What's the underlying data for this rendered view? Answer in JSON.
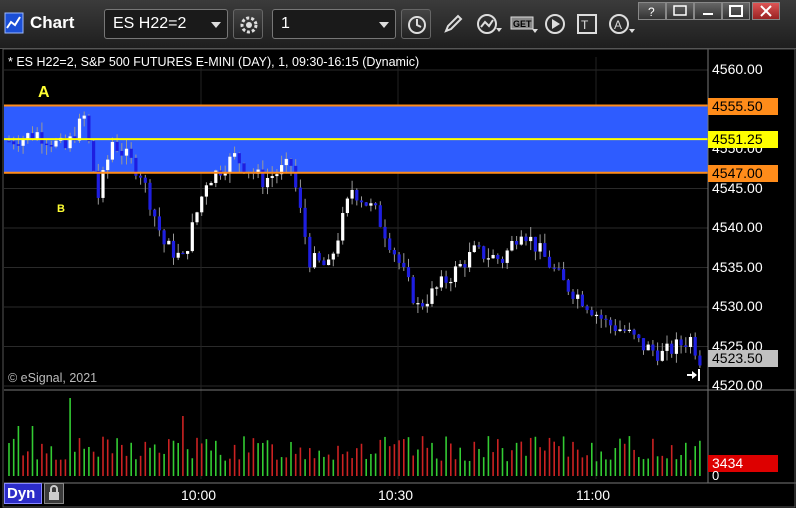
{
  "window": {
    "title": "Chart",
    "symbol": "ES H22=2",
    "interval": "1",
    "tools": [
      "timeframe-icon",
      "pencil-icon",
      "study-icon",
      "get-icon",
      "play-icon",
      "template-icon",
      "alert-icon"
    ]
  },
  "chart": {
    "title_line": "* ES H22=2, S&P 500 FUTURES E-MINI (DAY), 1, 09:30-16:15 (Dynamic)",
    "copyright": "© eSignal, 2021",
    "price_ticks": [
      "4560.00",
      "4555.00",
      "4550.00",
      "4545.00",
      "4540.00",
      "4535.00",
      "4530.00",
      "4525.00",
      "4520.00"
    ],
    "price_markers": [
      {
        "label": "4555.50",
        "price": 4555.5,
        "bg": "#ff8c1a",
        "fg": "#000000"
      },
      {
        "label": "4551.25",
        "price": 4551.25,
        "bg": "#ffff00",
        "fg": "#000000"
      },
      {
        "label": "4547.00",
        "price": 4547.0,
        "bg": "#ff8c1a",
        "fg": "#000000"
      },
      {
        "label": "4523.50",
        "price": 4523.5,
        "bg": "#c0c0c0",
        "fg": "#000000"
      }
    ],
    "volume_marker": {
      "label": "3434",
      "bg": "#dd0000",
      "fg": "#ffffff"
    },
    "volume_zero_tick": "0",
    "time_labels": [
      "10:00",
      "10:30",
      "11:00"
    ],
    "annotation_a": "A",
    "annotation_b": "B",
    "dyn_button": "Dyn",
    "zone_color": "#2e5cff",
    "up_color": "#ffffff",
    "down_color": "#1e1ee0",
    "vol_up_color": "#33cc33",
    "vol_down_color": "#cc2222"
  },
  "chart_data": {
    "type": "candlestick",
    "price_range": [
      4520,
      4560
    ],
    "zone": {
      "high": 4555.5,
      "mid": 4551.25,
      "low": 4547.0
    },
    "last_price": 4523.5,
    "last_volume": 3434
  }
}
